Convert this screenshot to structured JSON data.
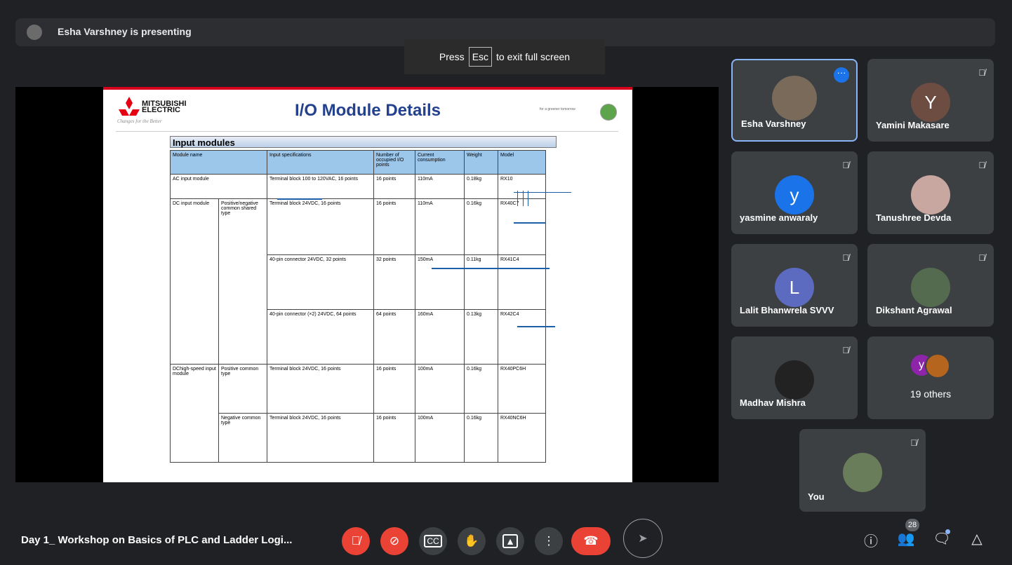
{
  "presenting_bar": {
    "text": "Esha Varshney is presenting"
  },
  "fullscreen_tip": {
    "press": "Press",
    "key": "Esc",
    "suffix": "to exit full screen"
  },
  "slide": {
    "logo_line1": "MITSUBISHI",
    "logo_line2": "ELECTRIC",
    "logo_tagline": "Changes for the Better",
    "title": "I/O Module Details",
    "corner_tagline": "for a greener tomorrow",
    "table_title": "Input modules",
    "headers": [
      "Module name",
      "Input specifications",
      "Number of occupied I/O points",
      "Current consumption",
      "Weight",
      "Model"
    ],
    "rows": [
      {
        "module": "AC input module",
        "spec": "Terminal block 100 to 120VAC, 16 points",
        "points": "16 points",
        "current": "110mA",
        "weight": "0.18kg",
        "model": "RX10"
      },
      {
        "module": "DC input module",
        "type": "Positive/negative common shared type",
        "spec": "Terminal block 24VDC, 16 points",
        "points": "16 points",
        "current": "110mA",
        "weight": "0.16kg",
        "model": "RX40C7"
      },
      {
        "spec": "40-pin connector 24VDC, 32 points",
        "points": "32 points",
        "current": "150mA",
        "weight": "0.11kg",
        "model": "RX41C4"
      },
      {
        "spec": "40-pin connector (×2) 24VDC, 64 points",
        "points": "64 points",
        "current": "160mA",
        "weight": "0.13kg",
        "model": "RX42C4"
      },
      {
        "module": "DChigh-speed input module",
        "type": "Positive common type",
        "spec": "Terminal block 24VDC, 16 points",
        "points": "16 points",
        "current": "100mA",
        "weight": "0.16kg",
        "model": "RX40PC6H"
      },
      {
        "type": "Negative common type",
        "spec": "Terminal block 24VDC, 16 points",
        "points": "16 points",
        "current": "100mA",
        "weight": "0.16kg",
        "model": "RX40NC6H"
      }
    ]
  },
  "participants": [
    {
      "name": "Esha Varshney",
      "initial": "",
      "color": "#7a6a5a"
    },
    {
      "name": "Yamini Makasare",
      "initial": "Y",
      "color": "#6d4c41"
    },
    {
      "name": "yasmine anwaraly",
      "initial": "y",
      "color": "#1a73e8"
    },
    {
      "name": "Tanushree Devda",
      "initial": "",
      "color": "#c8a7a0"
    },
    {
      "name": "Lalit Bhanwrela SVVV",
      "initial": "L",
      "color": "#5c6bc0"
    },
    {
      "name": "Dikshant Agrawal",
      "initial": "",
      "color": "#556b4f"
    },
    {
      "name": "Madhav Mishra",
      "initial": "",
      "color": "#222222"
    },
    {
      "name": "19 others",
      "initial": "y",
      "color": "#8e24aa"
    },
    {
      "name": "You",
      "initial": "",
      "color": "#6a7d5a"
    }
  ],
  "meeting": {
    "title": "Day 1_ Workshop on Basics of PLC and Ladder Logi...",
    "participant_count": "28"
  },
  "icons": {
    "mic_off": "mic-off-icon",
    "cam_off": "camera-off-icon",
    "captions": "captions-icon",
    "hand": "raise-hand-icon",
    "present": "present-icon",
    "more": "more-vert-icon",
    "hangup": "call-end-icon",
    "info": "info-icon",
    "people": "people-icon",
    "chat": "chat-icon",
    "activities": "activities-icon"
  },
  "colors": {
    "accent_red": "#ea4335",
    "tile_bg": "#3c4043",
    "bg": "#202124",
    "active_border": "#8ab4f8"
  }
}
